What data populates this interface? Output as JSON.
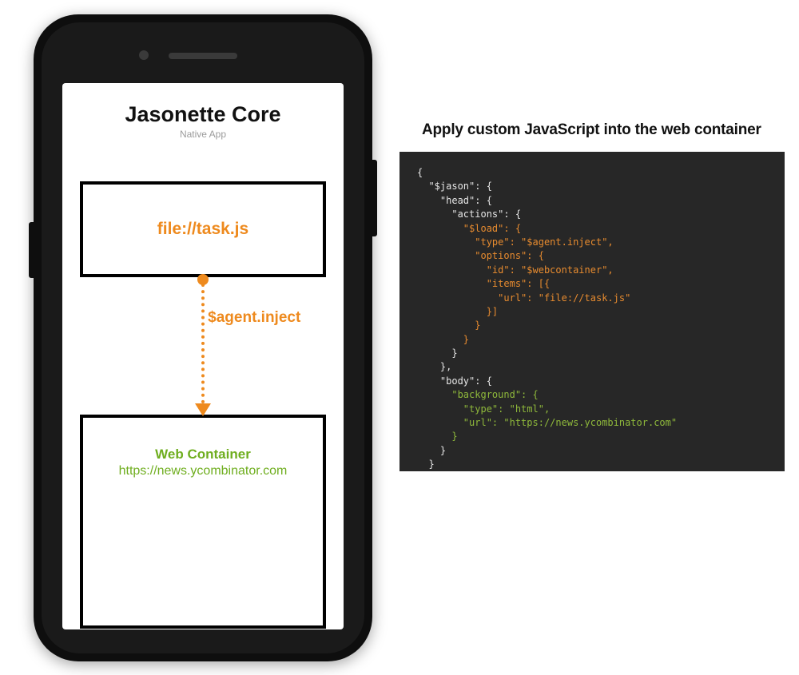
{
  "phone": {
    "title": "Jasonette Core",
    "subtitle": "Native App",
    "task_label": "file://task.js",
    "connector_label": "$agent.inject",
    "web_title": "Web Container",
    "web_url": "https://news.ycombinator.com"
  },
  "caption": "Apply custom JavaScript into the web container",
  "code_tokens": [
    {
      "cls": "w",
      "text": "{\n"
    },
    {
      "cls": "w",
      "text": "  \"$jason\": {\n"
    },
    {
      "cls": "w",
      "text": "    \"head\": {\n"
    },
    {
      "cls": "w",
      "text": "      \"actions\": {\n"
    },
    {
      "cls": "o",
      "text": "        \"$load\": {\n"
    },
    {
      "cls": "o",
      "text": "          \"type\": \"$agent.inject\",\n"
    },
    {
      "cls": "o",
      "text": "          \"options\": {\n"
    },
    {
      "cls": "o",
      "text": "            \"id\": \"$webcontainer\",\n"
    },
    {
      "cls": "o",
      "text": "            \"items\": [{\n"
    },
    {
      "cls": "o",
      "text": "              \"url\": \"file://task.js\"\n"
    },
    {
      "cls": "o",
      "text": "            }]\n"
    },
    {
      "cls": "o",
      "text": "          }\n"
    },
    {
      "cls": "o",
      "text": "        }\n"
    },
    {
      "cls": "w",
      "text": "      }\n"
    },
    {
      "cls": "w",
      "text": "    },\n"
    },
    {
      "cls": "w",
      "text": "    \"body\": {\n"
    },
    {
      "cls": "g",
      "text": "      \"background\": {\n"
    },
    {
      "cls": "g",
      "text": "        \"type\": \"html\",\n"
    },
    {
      "cls": "g",
      "text": "        \"url\": \"https://news.ycombinator.com\"\n"
    },
    {
      "cls": "g",
      "text": "      }\n"
    },
    {
      "cls": "w",
      "text": "    }\n"
    },
    {
      "cls": "w",
      "text": "  }\n"
    },
    {
      "cls": "w",
      "text": "}"
    }
  ],
  "colors": {
    "orange": "#ee8a1e",
    "green_dark": "#6fae1f",
    "green_code": "#8fb93b",
    "code_bg": "#272727"
  }
}
